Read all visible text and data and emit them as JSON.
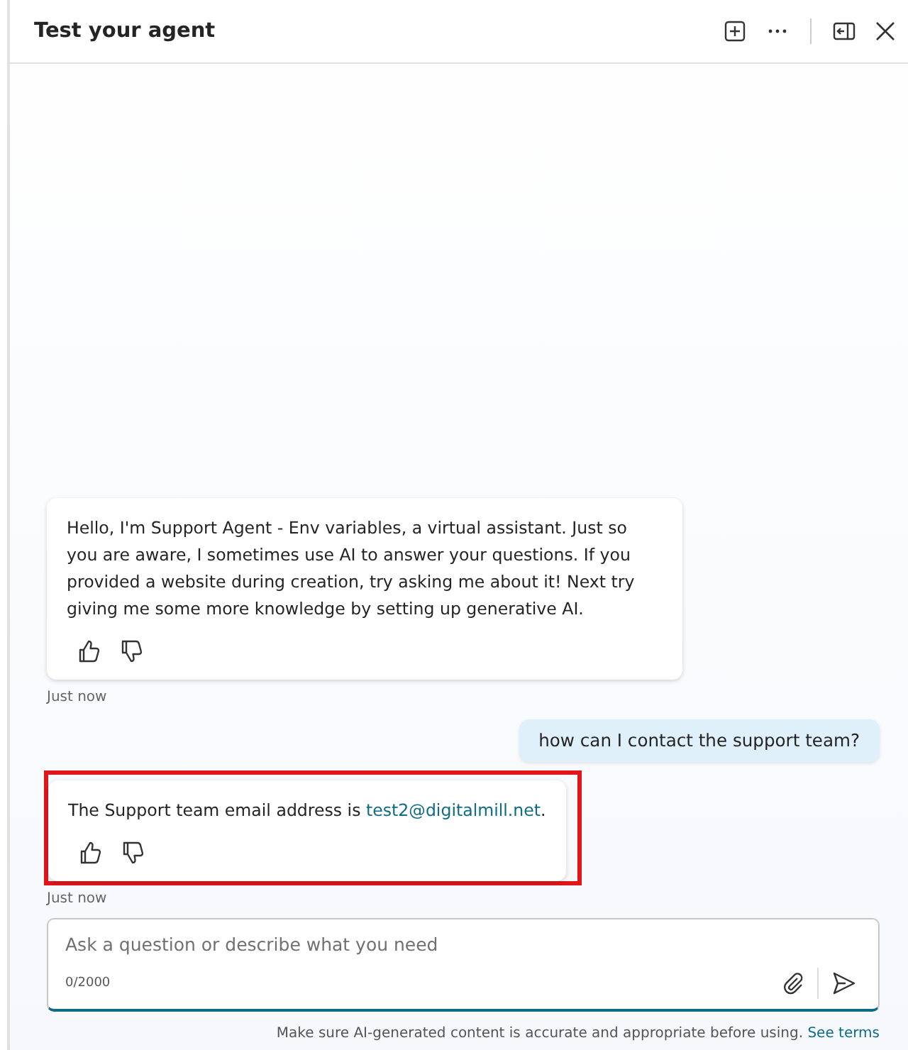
{
  "window": {
    "title": "Test your agent"
  },
  "messages": [
    {
      "kind": "bot",
      "text": "Hello, I'm Support Agent - Env variables, a virtual assistant. Just so you are aware, I sometimes use AI to answer your questions. If you provided a website during creation, try asking me about it! Next try giving me some more knowledge by setting up generative AI.",
      "timestamp": "Just now",
      "highlighted": false
    },
    {
      "kind": "user",
      "text": "how can I contact the support team?"
    },
    {
      "kind": "bot",
      "text": "The Support team email address is ",
      "link": "test2@digitalmill.net",
      "text_after": ".",
      "timestamp": "Just now",
      "highlighted": true
    }
  ],
  "input": {
    "placeholder": "Ask a question or describe what you need",
    "counter": "0/2000"
  },
  "footer": {
    "text": "Make sure AI-generated content is accurate and appropriate before using.",
    "link": "See terms"
  }
}
